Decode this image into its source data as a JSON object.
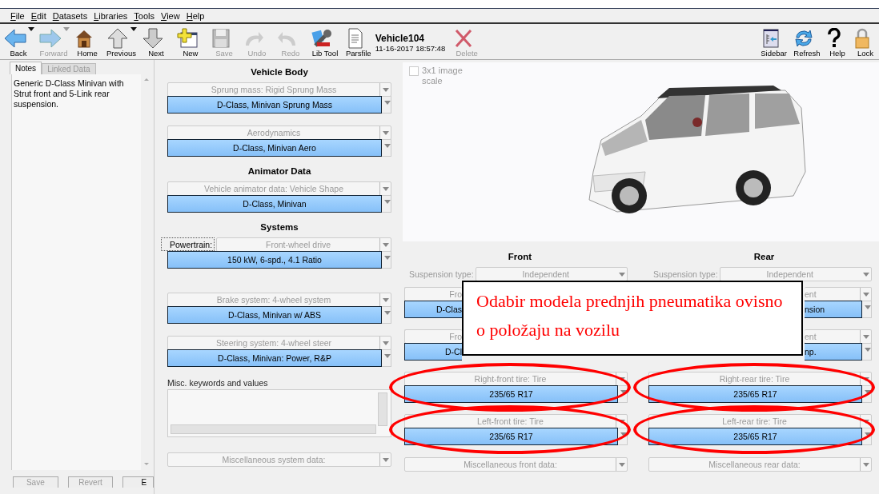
{
  "menu": [
    "File",
    "Edit",
    "Datasets",
    "Libraries",
    "Tools",
    "View",
    "Help"
  ],
  "toolbar": {
    "items": [
      {
        "kind": "button",
        "label": "Back",
        "menu": true,
        "disabled": false
      },
      {
        "kind": "button",
        "label": "Forward",
        "menu": true,
        "disabled": true
      },
      {
        "kind": "button",
        "label": "Home",
        "menu": false,
        "disabled": false
      },
      {
        "kind": "button",
        "label": "Previous",
        "menu": true,
        "disabled": false
      },
      {
        "kind": "button",
        "label": "Next",
        "menu": false,
        "disabled": false
      },
      {
        "kind": "button",
        "label": "New",
        "menu": false,
        "disabled": false
      },
      {
        "kind": "button",
        "label": "Save",
        "menu": false,
        "disabled": true
      },
      {
        "kind": "button",
        "label": "Undo",
        "menu": false,
        "disabled": true
      },
      {
        "kind": "button",
        "label": "Redo",
        "menu": false,
        "disabled": true
      },
      {
        "kind": "button",
        "label": "Lib Tool",
        "menu": false,
        "disabled": false
      },
      {
        "kind": "button",
        "label": "Parsfile",
        "menu": false,
        "disabled": false
      },
      {
        "kind": "document",
        "title": "Vehicle104",
        "date": "11-16-2017 18:57:48"
      },
      {
        "kind": "button",
        "label": "Delete",
        "menu": false,
        "disabled": true
      }
    ],
    "right_items": [
      {
        "label": "Sidebar",
        "disabled": false
      },
      {
        "label": "Refresh",
        "disabled": false
      },
      {
        "label": "Help",
        "disabled": false
      },
      {
        "label": "Lock",
        "disabled": false
      }
    ]
  },
  "left_panel": {
    "tabs": [
      {
        "label": "Notes",
        "selected": true
      },
      {
        "label": "Linked Data",
        "selected": false
      }
    ],
    "notes": "Generic D-Class Minivan with Strut front and 5-Link rear suspension.",
    "buttons": [
      {
        "label": "Save",
        "disabled": true
      },
      {
        "label": "Revert",
        "disabled": true
      },
      {
        "label": "E",
        "disabled": false
      }
    ]
  },
  "vehicle": [
    {
      "kind": "heading",
      "text": "Vehicle Body"
    },
    {
      "kind": "pair",
      "label": "Sprung mass: Rigid Sprung Mass",
      "value": "D-Class, Minivan Sprung Mass"
    },
    {
      "kind": "pair",
      "label": "Aerodynamics",
      "value": "D-Class, Minivan Aero"
    },
    {
      "kind": "heading",
      "text": "Animator Data"
    },
    {
      "kind": "pair",
      "label": "Vehicle animator data: Vehicle Shape",
      "value": "D-Class, Minivan"
    },
    {
      "kind": "heading",
      "text": "Systems"
    },
    {
      "kind": "pair",
      "prefix": "Powertrain:",
      "label": "Front-wheel drive",
      "value": "150 kW, 6-spd., 4.1 Ratio"
    },
    {
      "kind": "pair",
      "label": "Brake system: 4-wheel system",
      "value": "D-Class, Minivan w/ ABS"
    },
    {
      "kind": "pair",
      "label": "Steering system: 4-wheel steer",
      "value": "D-Class, Minivan: Power, R&P"
    },
    {
      "kind": "keywords",
      "label": "Misc. keywords and values"
    },
    {
      "kind": "single",
      "label": "Miscellaneous system data:"
    }
  ],
  "image": {
    "checkbox": {
      "label": "3x1 image scale",
      "checked": false
    }
  },
  "axles": [
    {
      "title": "Front",
      "suspension_label": "Suspension type:",
      "suspension_value": "Independent",
      "rows": [
        {
          "kind": "covered",
          "label": "Fro",
          "value": "D-Clas",
          "highlighted": false
        },
        {
          "kind": "covered",
          "label": "Fro",
          "value": "D-Cl",
          "highlighted": false
        },
        {
          "kind": "pair",
          "label": "Right-front tire: Tire",
          "value": "235/65 R17",
          "highlighted": true
        },
        {
          "kind": "pair",
          "label": "Left-front tire: Tire",
          "value": "235/65 R17",
          "highlighted": true
        },
        {
          "kind": "single",
          "label": "Miscellaneous front data:"
        }
      ]
    },
    {
      "title": "Rear",
      "suspension_label": "Suspension type:",
      "suspension_value": "Independent",
      "rows": [
        {
          "kind": "covered",
          "label": "ent",
          "value": "nsion",
          "highlighted": false
        },
        {
          "kind": "covered",
          "label": "ent",
          "value": "np.",
          "highlighted": false
        },
        {
          "kind": "pair",
          "label": "Right-rear tire: Tire",
          "value": "235/65 R17",
          "highlighted": true
        },
        {
          "kind": "pair",
          "label": "Left-rear tire: Tire",
          "value": "235/65 R17",
          "highlighted": true
        },
        {
          "kind": "single",
          "label": "Miscellaneous rear data:"
        }
      ]
    }
  ],
  "annotation": {
    "text": "Odabir modela prednjih pneumatika ovisno o položaju na vozilu"
  }
}
